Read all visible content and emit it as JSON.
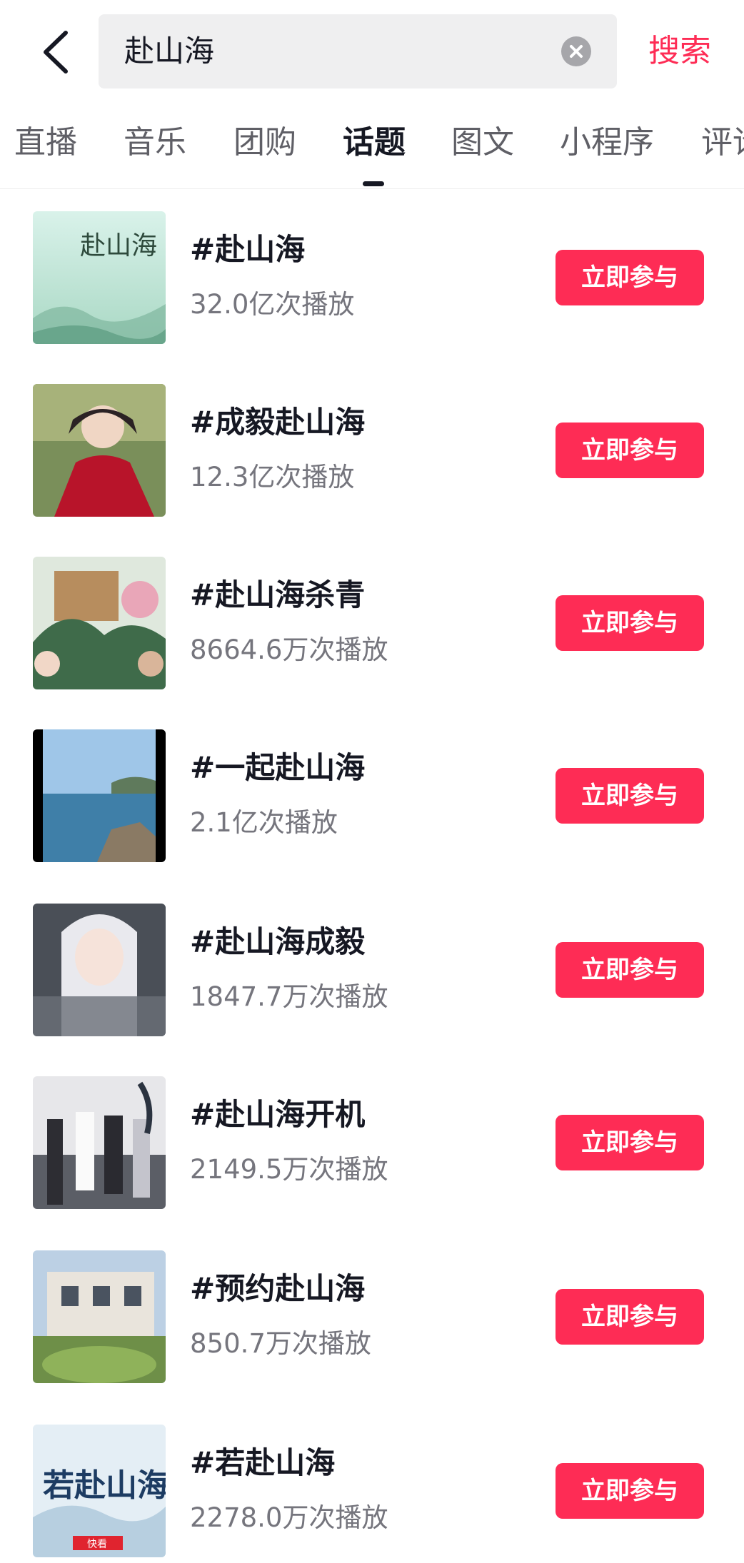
{
  "search": {
    "query": "赴山海",
    "submit_label": "搜索"
  },
  "tabs": [
    {
      "label": "直播"
    },
    {
      "label": "音乐"
    },
    {
      "label": "团购"
    },
    {
      "label": "话题",
      "active": true
    },
    {
      "label": "图文"
    },
    {
      "label": "小程序"
    },
    {
      "label": "评论"
    }
  ],
  "topics": [
    {
      "title": "#赴山海",
      "plays": "32.0亿次播放",
      "action": "立即参与",
      "thumb_overlay": "赴山海"
    },
    {
      "title": "#成毅赴山海",
      "plays": "12.3亿次播放",
      "action": "立即参与"
    },
    {
      "title": "#赴山海杀青",
      "plays": "8664.6万次播放",
      "action": "立即参与"
    },
    {
      "title": "#一起赴山海",
      "plays": "2.1亿次播放",
      "action": "立即参与"
    },
    {
      "title": "#赴山海成毅",
      "plays": "1847.7万次播放",
      "action": "立即参与"
    },
    {
      "title": "#赴山海开机",
      "plays": "2149.5万次播放",
      "action": "立即参与"
    },
    {
      "title": "#预约赴山海",
      "plays": "850.7万次播放",
      "action": "立即参与"
    },
    {
      "title": "#若赴山海",
      "plays": "2278.0万次播放",
      "action": "立即参与",
      "thumb_overlay": "若赴山海",
      "thumb_badge": "快看"
    }
  ],
  "colors": {
    "accent": "#fe2c55",
    "text_primary": "#161823",
    "text_secondary": "#75757d"
  },
  "icons": {
    "back": "chevron-left-icon",
    "clear": "close-circle-icon"
  }
}
